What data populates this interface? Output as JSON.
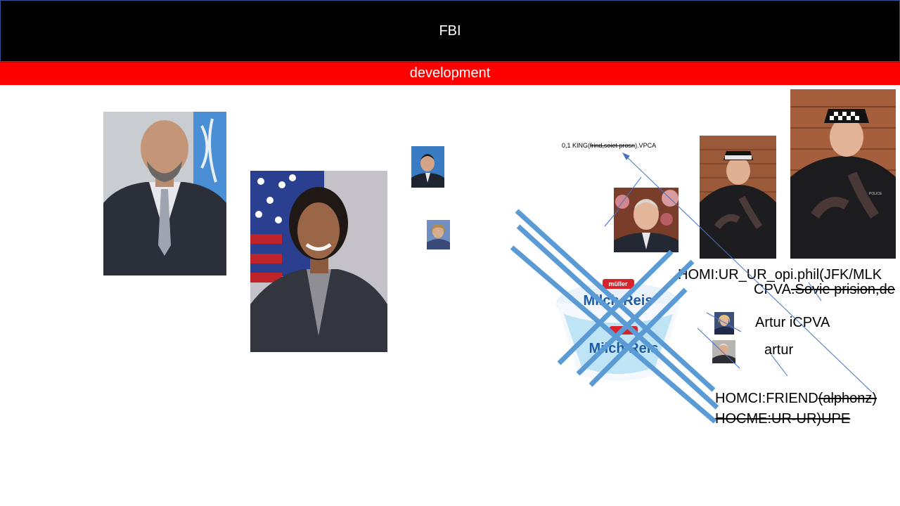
{
  "slide": {
    "title": "FBI",
    "subtitle": "development",
    "colors": {
      "title_bar": "#000000",
      "subtitle_bar": "#ff0000",
      "accent_lines": "#5b9bd5",
      "thin_lines": "#4472c4"
    }
  },
  "annotations": {
    "king_note_prefix": "0,1 KING(",
    "king_note_strike": "frind,soiet prosn",
    "king_note_suffix": ").VPCA",
    "homi_line": "HOMI:UR_UR_opi.phil(JFK/MLK",
    "cpva_prefix": "CPVA",
    "cpva_strike": ".Sovie prision,de",
    "artur_icpva": "Artur iCPVA",
    "artur": "artur",
    "homci_prefix": "HOMCI:FRIEND",
    "homci_strike": "(alphonz)",
    "hocme_line": "HOCME:UR-UR)UPE"
  },
  "images": {
    "yogurt_brand": "müller",
    "yogurt_product": "Milch Reis",
    "police_badge": "POLICE"
  }
}
